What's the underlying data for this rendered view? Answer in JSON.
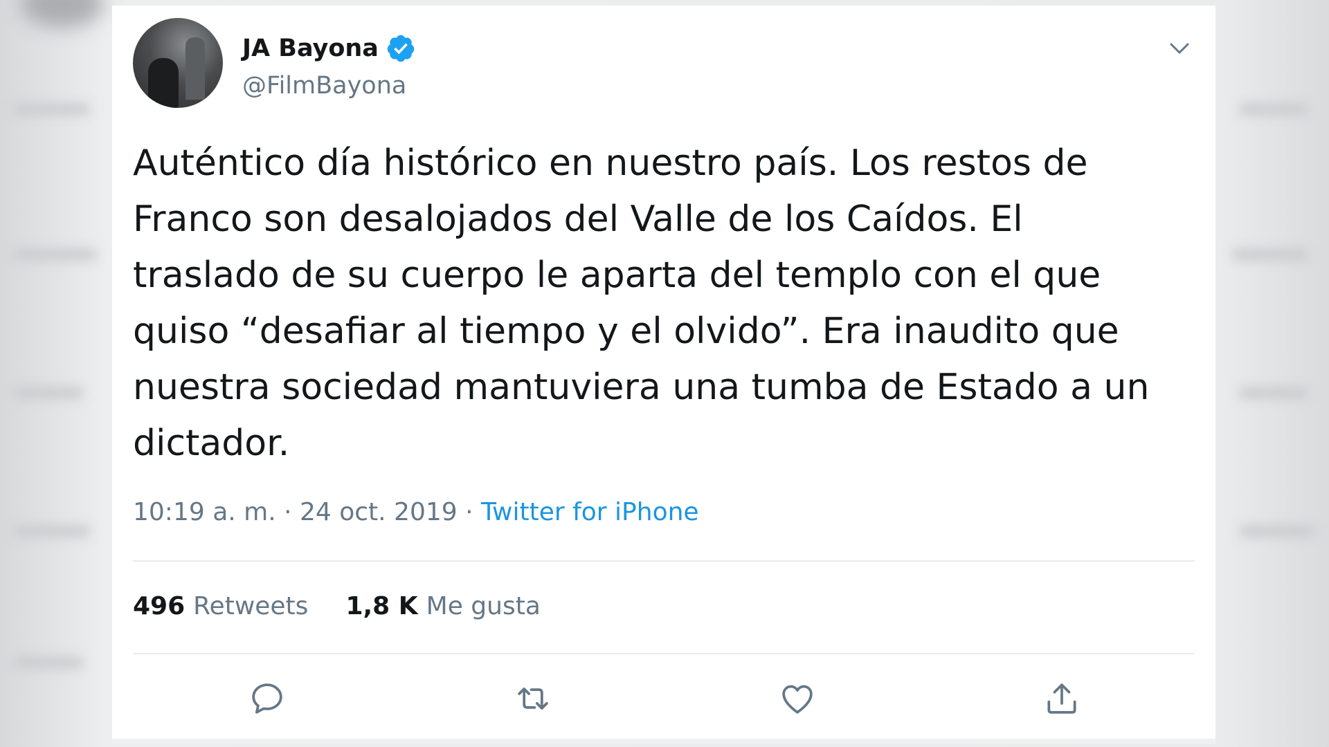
{
  "tweet": {
    "display_name": "JA Bayona",
    "handle": "@FilmBayona",
    "text": "Auténtico día histórico en nuestro país. Los restos de\nFranco son desalojados del Valle de los Caídos. El\ntraslado de su cuerpo le aparta del templo con el que\nquiso “desafiar al tiempo y el olvido”. Era inaudito que\nnuestra sociedad mantuviera una tumba de Estado a un\ndictador.",
    "time": "10:19 a. m. · 24 oct. 2019 · ",
    "source": "Twitter for iPhone",
    "retweets_count": "496",
    "retweets_label": "Retweets",
    "likes_count": "1,8 K",
    "likes_label": "Me gusta"
  },
  "colors": {
    "accent": "#1b95e0",
    "verified": "#1da1f2",
    "text": "#14171a",
    "secondary": "#657786"
  },
  "icons": [
    "verified-badge-icon",
    "chevron-down-icon",
    "reply-icon",
    "retweet-icon",
    "like-icon",
    "share-icon"
  ]
}
